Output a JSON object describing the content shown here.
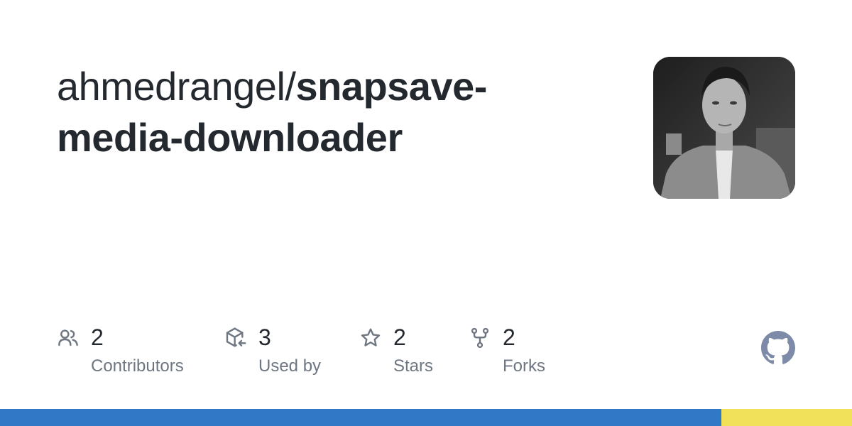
{
  "repo": {
    "owner": "ahmedrangel/",
    "name_line1": "snapsave-",
    "name_line2": "media-downloader"
  },
  "avatar": {
    "alt": "ahmedrangel avatar"
  },
  "stats": [
    {
      "icon": "people-icon",
      "value": "2",
      "label": "Contributors"
    },
    {
      "icon": "package-dependents-icon",
      "value": "3",
      "label": "Used by"
    },
    {
      "icon": "star-icon",
      "value": "2",
      "label": "Stars"
    },
    {
      "icon": "repo-forked-icon",
      "value": "2",
      "label": "Forks"
    }
  ],
  "language_bar": [
    {
      "color": "#3178c6",
      "percent": 84.7
    },
    {
      "color": "#f1e05a",
      "percent": 15.3
    }
  ],
  "colors": {
    "text": "#24292f",
    "muted": "#6e7781",
    "icon": "#6e7781",
    "github_logo": "#7d8ba8"
  }
}
